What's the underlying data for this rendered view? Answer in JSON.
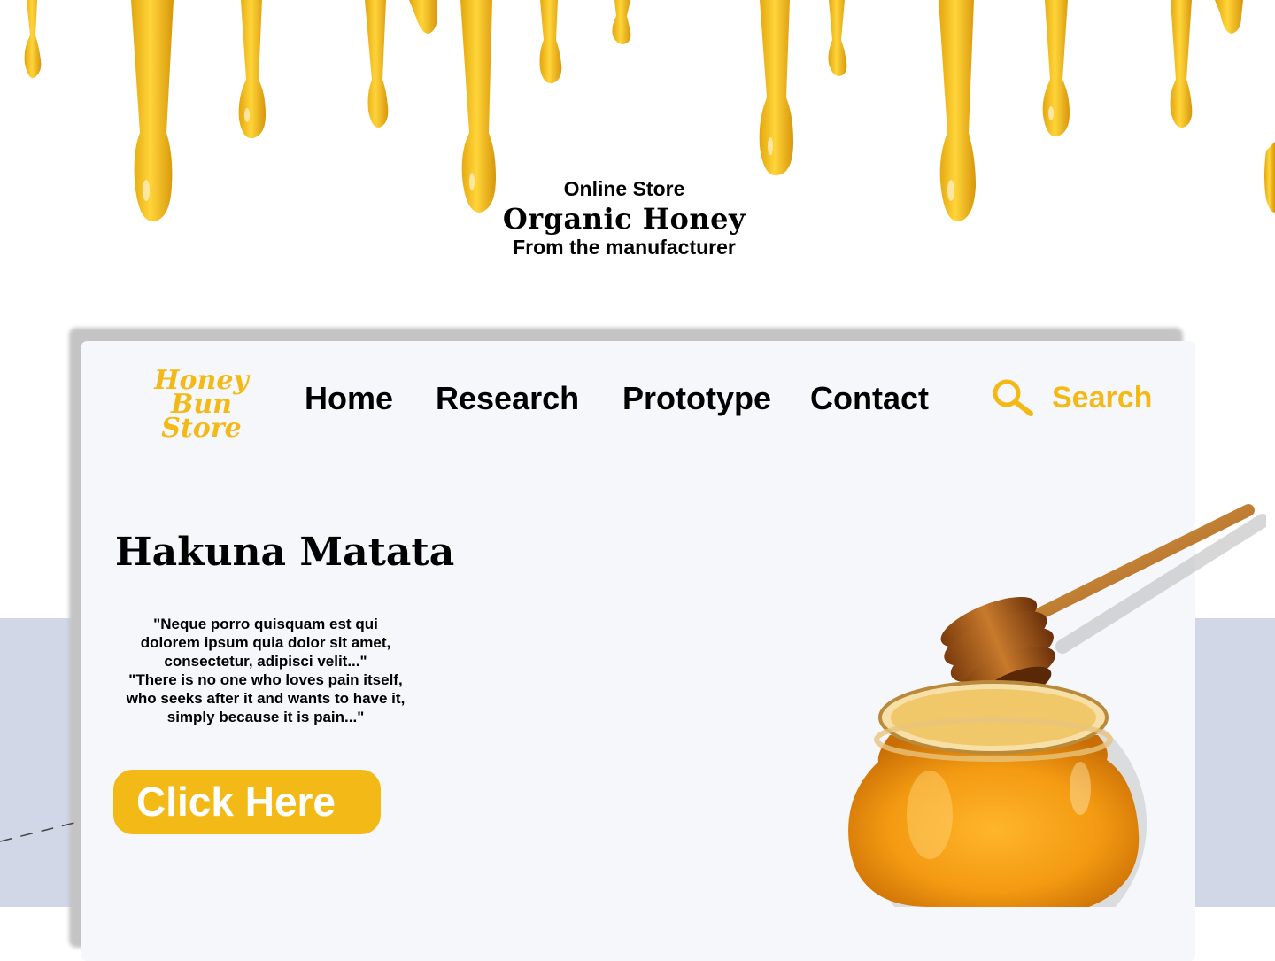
{
  "hero": {
    "line1": "Online Store",
    "line2": "Organic Honey",
    "line3": "From the manufacturer"
  },
  "logo": {
    "line1": "Honey Bun",
    "line2": "Store"
  },
  "nav": [
    {
      "label": "Home"
    },
    {
      "label": "Research"
    },
    {
      "label": "Prototype"
    },
    {
      "label": "Contact"
    }
  ],
  "search": {
    "label": "Search",
    "icon": "magnifier-icon"
  },
  "main": {
    "headline": "Hakuna Matata",
    "quote_lines": [
      "\"Neque porro quisquam est qui",
      "dolorem ipsum quia dolor sit amet,",
      "consectetur, adipisci velit...\"",
      "\"There is no one who loves pain itself,",
      "who seeks after it and wants to have it,",
      "simply because it is pain...\""
    ],
    "cta_label": "Click Here"
  },
  "colors": {
    "accent": "#f3b917",
    "card_bg": "#f6f7fb",
    "band_bg": "#d2d7e8"
  }
}
